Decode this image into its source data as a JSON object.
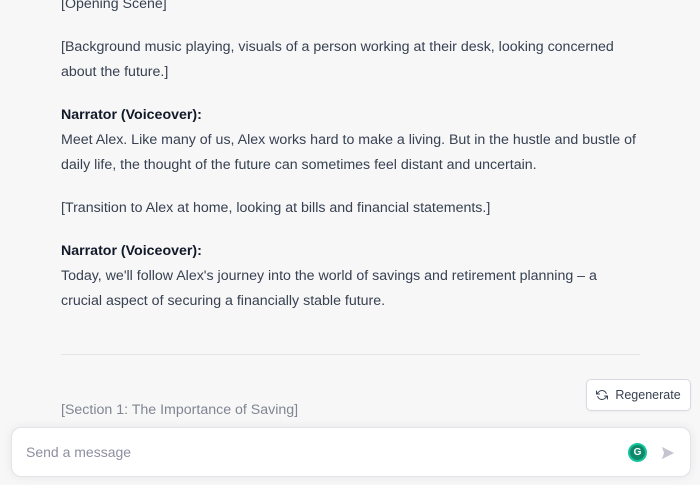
{
  "conversation": {
    "assistant_message": {
      "opening_scene": "[Opening Scene]",
      "background_note": "[Background music playing, visuals of a person working at their desk, looking concerned about the future.]",
      "narrator_1_label": "Narrator (Voiceover):",
      "narrator_1_text": "Meet Alex. Like many of us, Alex works hard to make a living. But in the hustle and bustle of daily life, the thought of the future can sometimes feel distant and uncertain.",
      "transition_note": "[Transition to Alex at home, looking at bills and financial statements.]",
      "narrator_2_label": "Narrator (Voiceover):",
      "narrator_2_text": "Today, we'll follow Alex's journey into the world of savings and retirement planning – a crucial aspect of securing a financially stable future."
    },
    "next_section_preview": "[Section 1: The Importance of Saving]"
  },
  "actions": {
    "regenerate_label": "Regenerate",
    "regenerate_icon": "refresh-icon"
  },
  "composer": {
    "placeholder": "Send a message",
    "value": "",
    "grammarly_icon": "grammarly-icon",
    "grammarly_letter": "G",
    "send_icon": "send-icon"
  },
  "colors": {
    "background": "#f7f7f8",
    "text": "#374151",
    "grammarly_green": "#15c39a"
  }
}
